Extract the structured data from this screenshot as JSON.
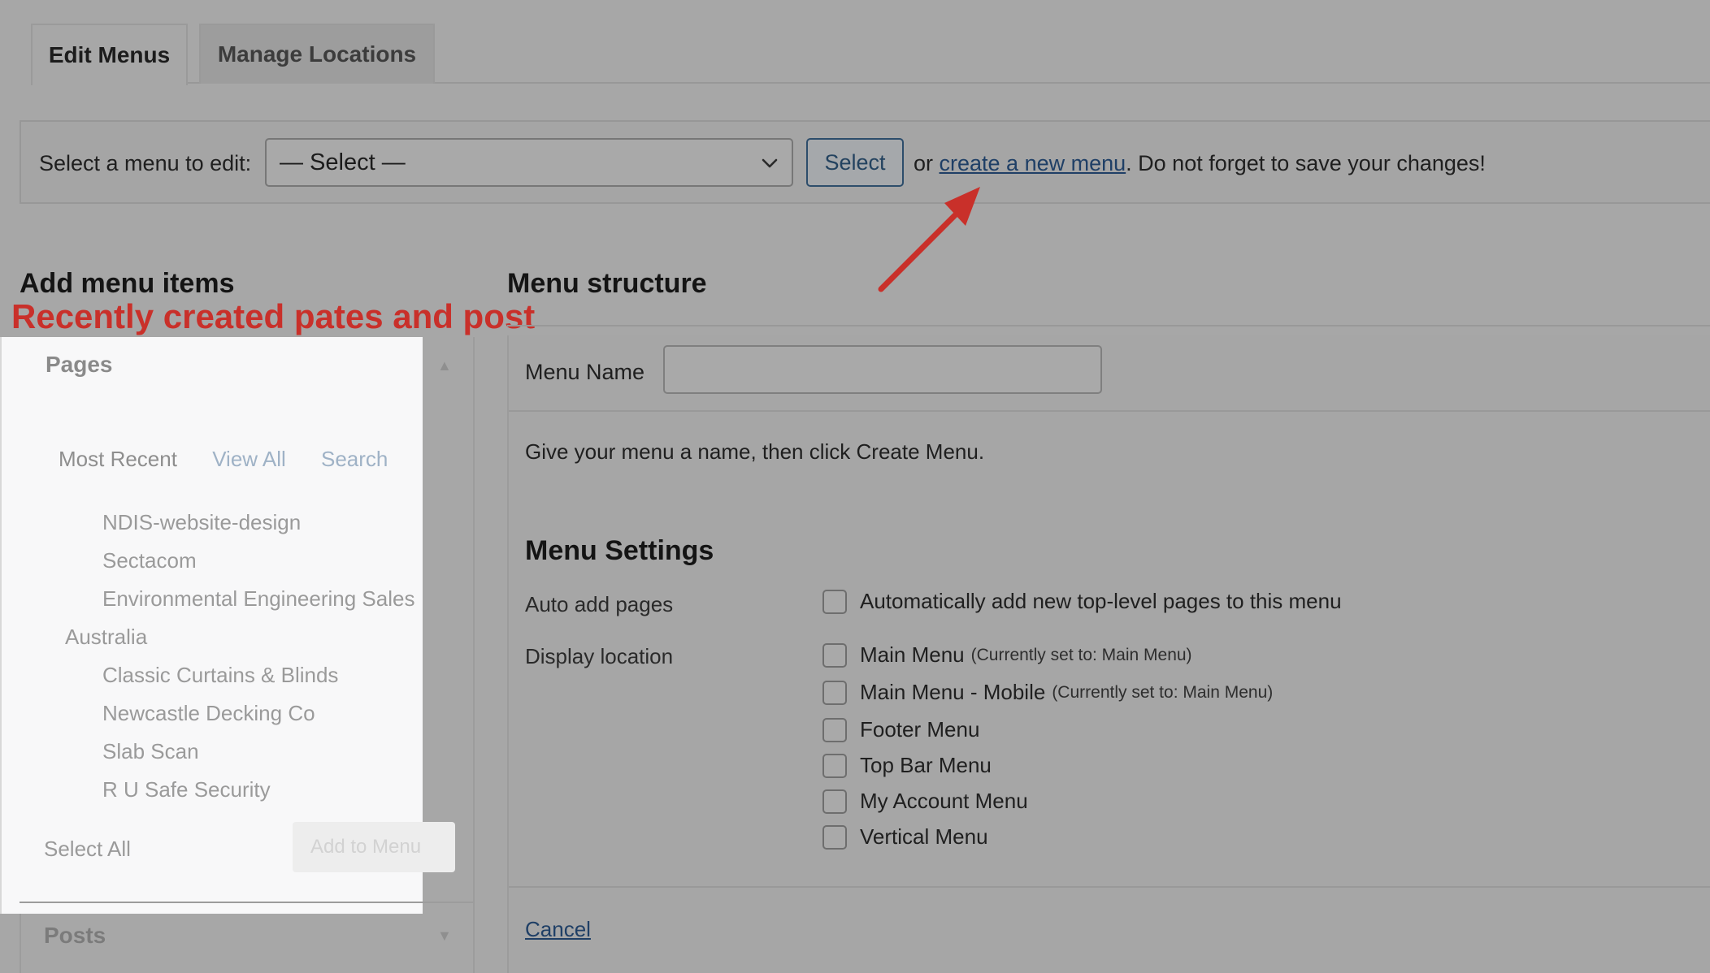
{
  "tabs": {
    "edit": "Edit Menus",
    "manage": "Manage Locations"
  },
  "select_bar": {
    "label": "Select a menu to edit:",
    "selected": "— Select —",
    "button": "Select",
    "hint_prefix": "or ",
    "hint_link": "create a new menu",
    "hint_suffix": ". Do not forget to save your changes!"
  },
  "annotation": {
    "text": "Recently created pates and post",
    "color": "#c9302a"
  },
  "left": {
    "heading": "Add menu items",
    "pages_title": "Pages",
    "tabs": [
      "Most Recent",
      "View All",
      "Search"
    ],
    "items": [
      "NDIS-website-design",
      "Sectacom",
      "Environmental Engineering Sales",
      "Australia",
      "Classic Curtains & Blinds",
      "Newcastle Decking Co",
      "Slab Scan",
      "R U Safe Security"
    ],
    "select_all": "Select All",
    "add_button": "Add to Menu",
    "posts_title": "Posts"
  },
  "right": {
    "heading": "Menu structure",
    "menu_name_label": "Menu Name",
    "instructions": "Give your menu a name, then click Create Menu.",
    "settings_title": "Menu Settings",
    "auto_add_label": "Auto add pages",
    "auto_add_option": "Automatically add new top-level pages to this menu",
    "display_location_label": "Display location",
    "locations": [
      {
        "label": "Main Menu",
        "note": "(Currently set to: Main Menu)"
      },
      {
        "label": "Main Menu - Mobile",
        "note": "(Currently set to: Main Menu)"
      },
      {
        "label": "Footer Menu",
        "note": ""
      },
      {
        "label": "Top Bar Menu",
        "note": ""
      },
      {
        "label": "My Account Menu",
        "note": ""
      },
      {
        "label": "Vertical Menu",
        "note": ""
      }
    ],
    "cancel": "Cancel"
  }
}
